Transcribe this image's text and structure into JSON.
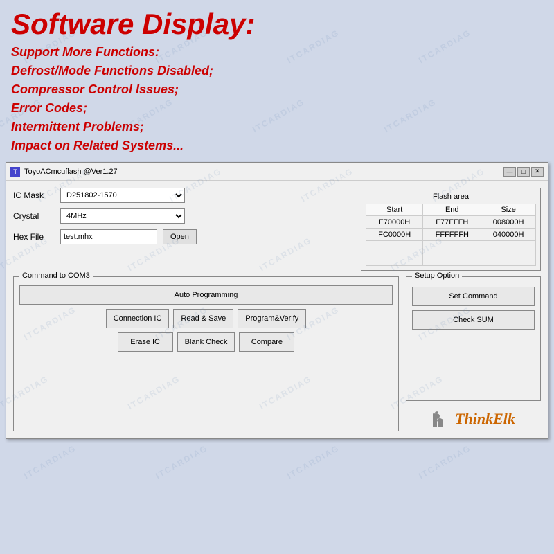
{
  "header": {
    "title": "Software Display:",
    "features": [
      "Support More Functions:",
      "Defrost/Mode Functions Disabled;",
      "Compressor Control Issues;",
      "Error Codes;",
      "Intermittent Problems;",
      "Impact on Related Systems..."
    ]
  },
  "window": {
    "title": "ToyoACmcuflash @Ver1.27",
    "controls": {
      "minimize": "—",
      "restore": "□",
      "close": "✕"
    }
  },
  "form": {
    "ic_mask_label": "IC Mask",
    "ic_mask_value": "D251802-1570",
    "crystal_label": "Crystal",
    "crystal_value": "4MHz",
    "hex_file_label": "Hex File",
    "hex_file_value": "test.mhx",
    "open_button": "Open"
  },
  "flash_area": {
    "title": "Flash area",
    "headers": [
      "Start",
      "End",
      "Size"
    ],
    "rows": [
      [
        "F70000H",
        "F77FFFH",
        "008000H"
      ],
      [
        "FC0000H",
        "FFFFFFH",
        "040000H"
      ],
      [
        "",
        "",
        ""
      ],
      [
        "",
        "",
        ""
      ]
    ]
  },
  "command_group": {
    "title": "Command to COM3",
    "auto_programming": "Auto Programming",
    "row2": [
      "Connection IC",
      "Read & Save",
      "Program&Verify"
    ],
    "row3": [
      "Erase IC",
      "Blank Check",
      "Compare"
    ]
  },
  "setup_option": {
    "title": "Setup Option",
    "set_command": "Set Command",
    "check_sum": "Check SUM"
  },
  "branding": {
    "text": "ThinkElk"
  },
  "watermarks": [
    "ITCARDIAG",
    "ITCARDIAG",
    "ITCARDIAG"
  ]
}
